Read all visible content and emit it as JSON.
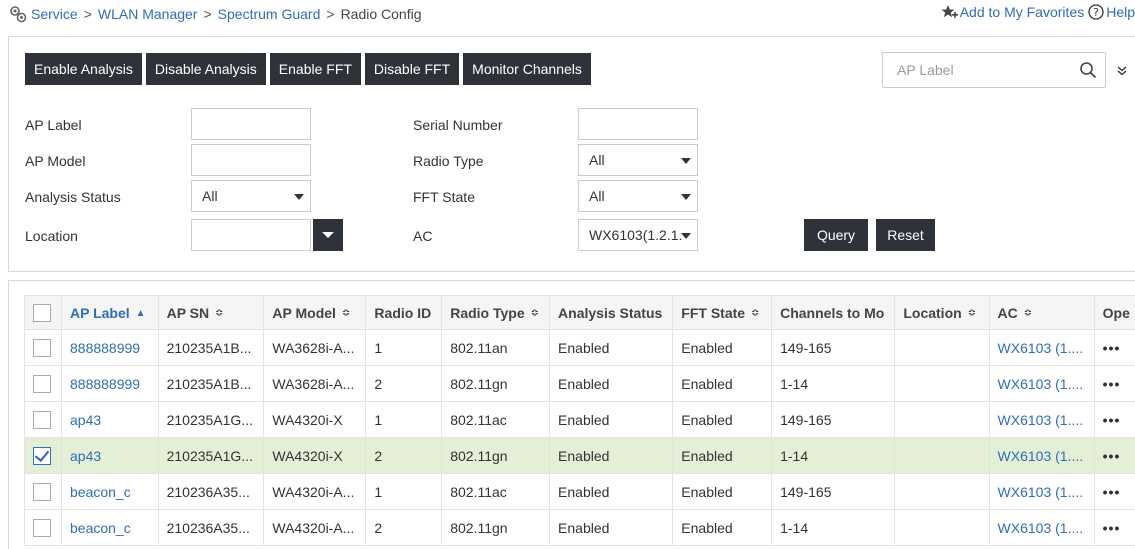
{
  "breadcrumb": {
    "items": [
      "Service",
      "WLAN Manager",
      "Spectrum Guard"
    ],
    "current": "Radio Config",
    "separator": ">"
  },
  "header": {
    "favorites": "Add to My Favorites",
    "help": "Help"
  },
  "toolbar": {
    "enable_analysis": "Enable Analysis",
    "disable_analysis": "Disable Analysis",
    "enable_fft": "Enable FFT",
    "disable_fft": "Disable FFT",
    "monitor_channels": "Monitor Channels"
  },
  "search": {
    "placeholder": "AP Label"
  },
  "filters": {
    "ap_label": "AP Label",
    "ap_model": "AP Model",
    "analysis_status": "Analysis Status",
    "analysis_status_value": "All",
    "location": "Location",
    "serial_number": "Serial Number",
    "radio_type": "Radio Type",
    "radio_type_value": "All",
    "fft_state": "FFT State",
    "fft_state_value": "All",
    "ac": "AC",
    "ac_value": "WX6103(1.2.1.",
    "query": "Query",
    "reset": "Reset"
  },
  "table": {
    "columns": [
      "AP Label",
      "AP SN",
      "AP Model",
      "Radio ID",
      "Radio Type",
      "Analysis Status",
      "FFT State",
      "Channels to Mo",
      "Location",
      "AC",
      "Ope"
    ],
    "sort_asc": "▲",
    "sort_both": "≎",
    "ops_glyph": "•••",
    "rows": [
      {
        "checked": false,
        "label": "888888999",
        "sn": "210235A1B...",
        "model": "WA3628i-A...",
        "radio_id": "1",
        "radio_type": "802.11an",
        "analysis": "Enabled",
        "fft": "Enabled",
        "channels": "149-165",
        "location": "",
        "ac": "WX6103 (1...."
      },
      {
        "checked": false,
        "label": "888888999",
        "sn": "210235A1B...",
        "model": "WA3628i-A...",
        "radio_id": "2",
        "radio_type": "802.11gn",
        "analysis": "Enabled",
        "fft": "Enabled",
        "channels": "1-14",
        "location": "",
        "ac": "WX6103 (1...."
      },
      {
        "checked": false,
        "label": "ap43",
        "sn": "210235A1G...",
        "model": "WA4320i-X",
        "radio_id": "1",
        "radio_type": "802.11ac",
        "analysis": "Enabled",
        "fft": "Enabled",
        "channels": "149-165",
        "location": "",
        "ac": "WX6103 (1...."
      },
      {
        "checked": true,
        "label": "ap43",
        "sn": "210235A1G...",
        "model": "WA4320i-X",
        "radio_id": "2",
        "radio_type": "802.11gn",
        "analysis": "Enabled",
        "fft": "Enabled",
        "channels": "1-14",
        "location": "",
        "ac": "WX6103 (1...."
      },
      {
        "checked": false,
        "label": "beacon_c",
        "sn": "210236A35...",
        "model": "WA4320i-A...",
        "radio_id": "1",
        "radio_type": "802.11ac",
        "analysis": "Enabled",
        "fft": "Enabled",
        "channels": "149-165",
        "location": "",
        "ac": "WX6103 (1...."
      },
      {
        "checked": false,
        "label": "beacon_c",
        "sn": "210236A35...",
        "model": "WA4320i-A...",
        "radio_id": "2",
        "radio_type": "802.11gn",
        "analysis": "Enabled",
        "fft": "Enabled",
        "channels": "1-14",
        "location": "",
        "ac": "WX6103 (1...."
      }
    ]
  },
  "colors": {
    "link": "#2f6db5",
    "dark_button": "#2e3339",
    "selected_row": "#e4efd6"
  }
}
